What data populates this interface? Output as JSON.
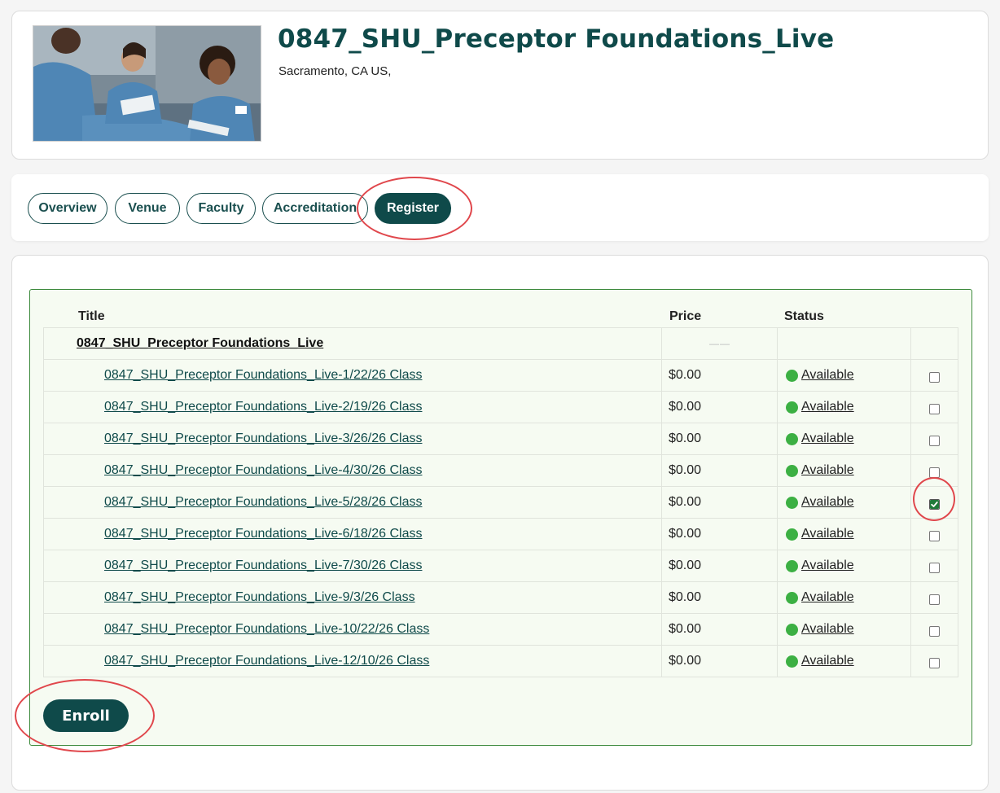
{
  "header": {
    "title": "0847_SHU_Preceptor Foundations_Live",
    "location": "Sacramento, CA US,"
  },
  "tabs": [
    {
      "label": "Overview"
    },
    {
      "label": "Venue"
    },
    {
      "label": "Faculty"
    },
    {
      "label": "Accreditation"
    },
    {
      "label": "Register",
      "active": true
    }
  ],
  "table": {
    "headers": {
      "title": "Title",
      "price": "Price",
      "status": "Status"
    },
    "parent": {
      "title": "0847_SHU_Preceptor Foundations_Live",
      "price": "——"
    },
    "rows": [
      {
        "title": "0847_SHU_Preceptor Foundations_Live-1/22/26 Class",
        "price": "$0.00",
        "status": "Available",
        "checked": false
      },
      {
        "title": "0847_SHU_Preceptor Foundations_Live-2/19/26 Class",
        "price": "$0.00",
        "status": "Available",
        "checked": false
      },
      {
        "title": "0847_SHU_Preceptor Foundations_Live-3/26/26 Class",
        "price": "$0.00",
        "status": "Available",
        "checked": false
      },
      {
        "title": "0847_SHU_Preceptor Foundations_Live-4/30/26 Class",
        "price": "$0.00",
        "status": "Available",
        "checked": false
      },
      {
        "title": "0847_SHU_Preceptor Foundations_Live-5/28/26 Class",
        "price": "$0.00",
        "status": "Available",
        "checked": true
      },
      {
        "title": "0847_SHU_Preceptor Foundations_Live-6/18/26 Class",
        "price": "$0.00",
        "status": "Available",
        "checked": false
      },
      {
        "title": "0847_SHU_Preceptor Foundations_Live-7/30/26 Class",
        "price": "$0.00",
        "status": "Available",
        "checked": false
      },
      {
        "title": "0847_SHU_Preceptor Foundations_Live-9/3/26 Class",
        "price": "$0.00",
        "status": "Available",
        "checked": false
      },
      {
        "title": "0847_SHU_Preceptor Foundations_Live-10/22/26 Class",
        "price": "$0.00",
        "status": "Available",
        "checked": false
      },
      {
        "title": "0847_SHU_Preceptor Foundations_Live-12/10/26 Class",
        "price": "$0.00",
        "status": "Available",
        "checked": false
      }
    ]
  },
  "actions": {
    "enroll_label": "Enroll"
  },
  "colors": {
    "brand": "#0f4a4a",
    "available": "#3cb043",
    "highlight_ring": "#e0474c",
    "table_border": "#3d8a3d"
  },
  "icons": {
    "status": "available-dot-icon",
    "check": "checkmark-icon"
  }
}
